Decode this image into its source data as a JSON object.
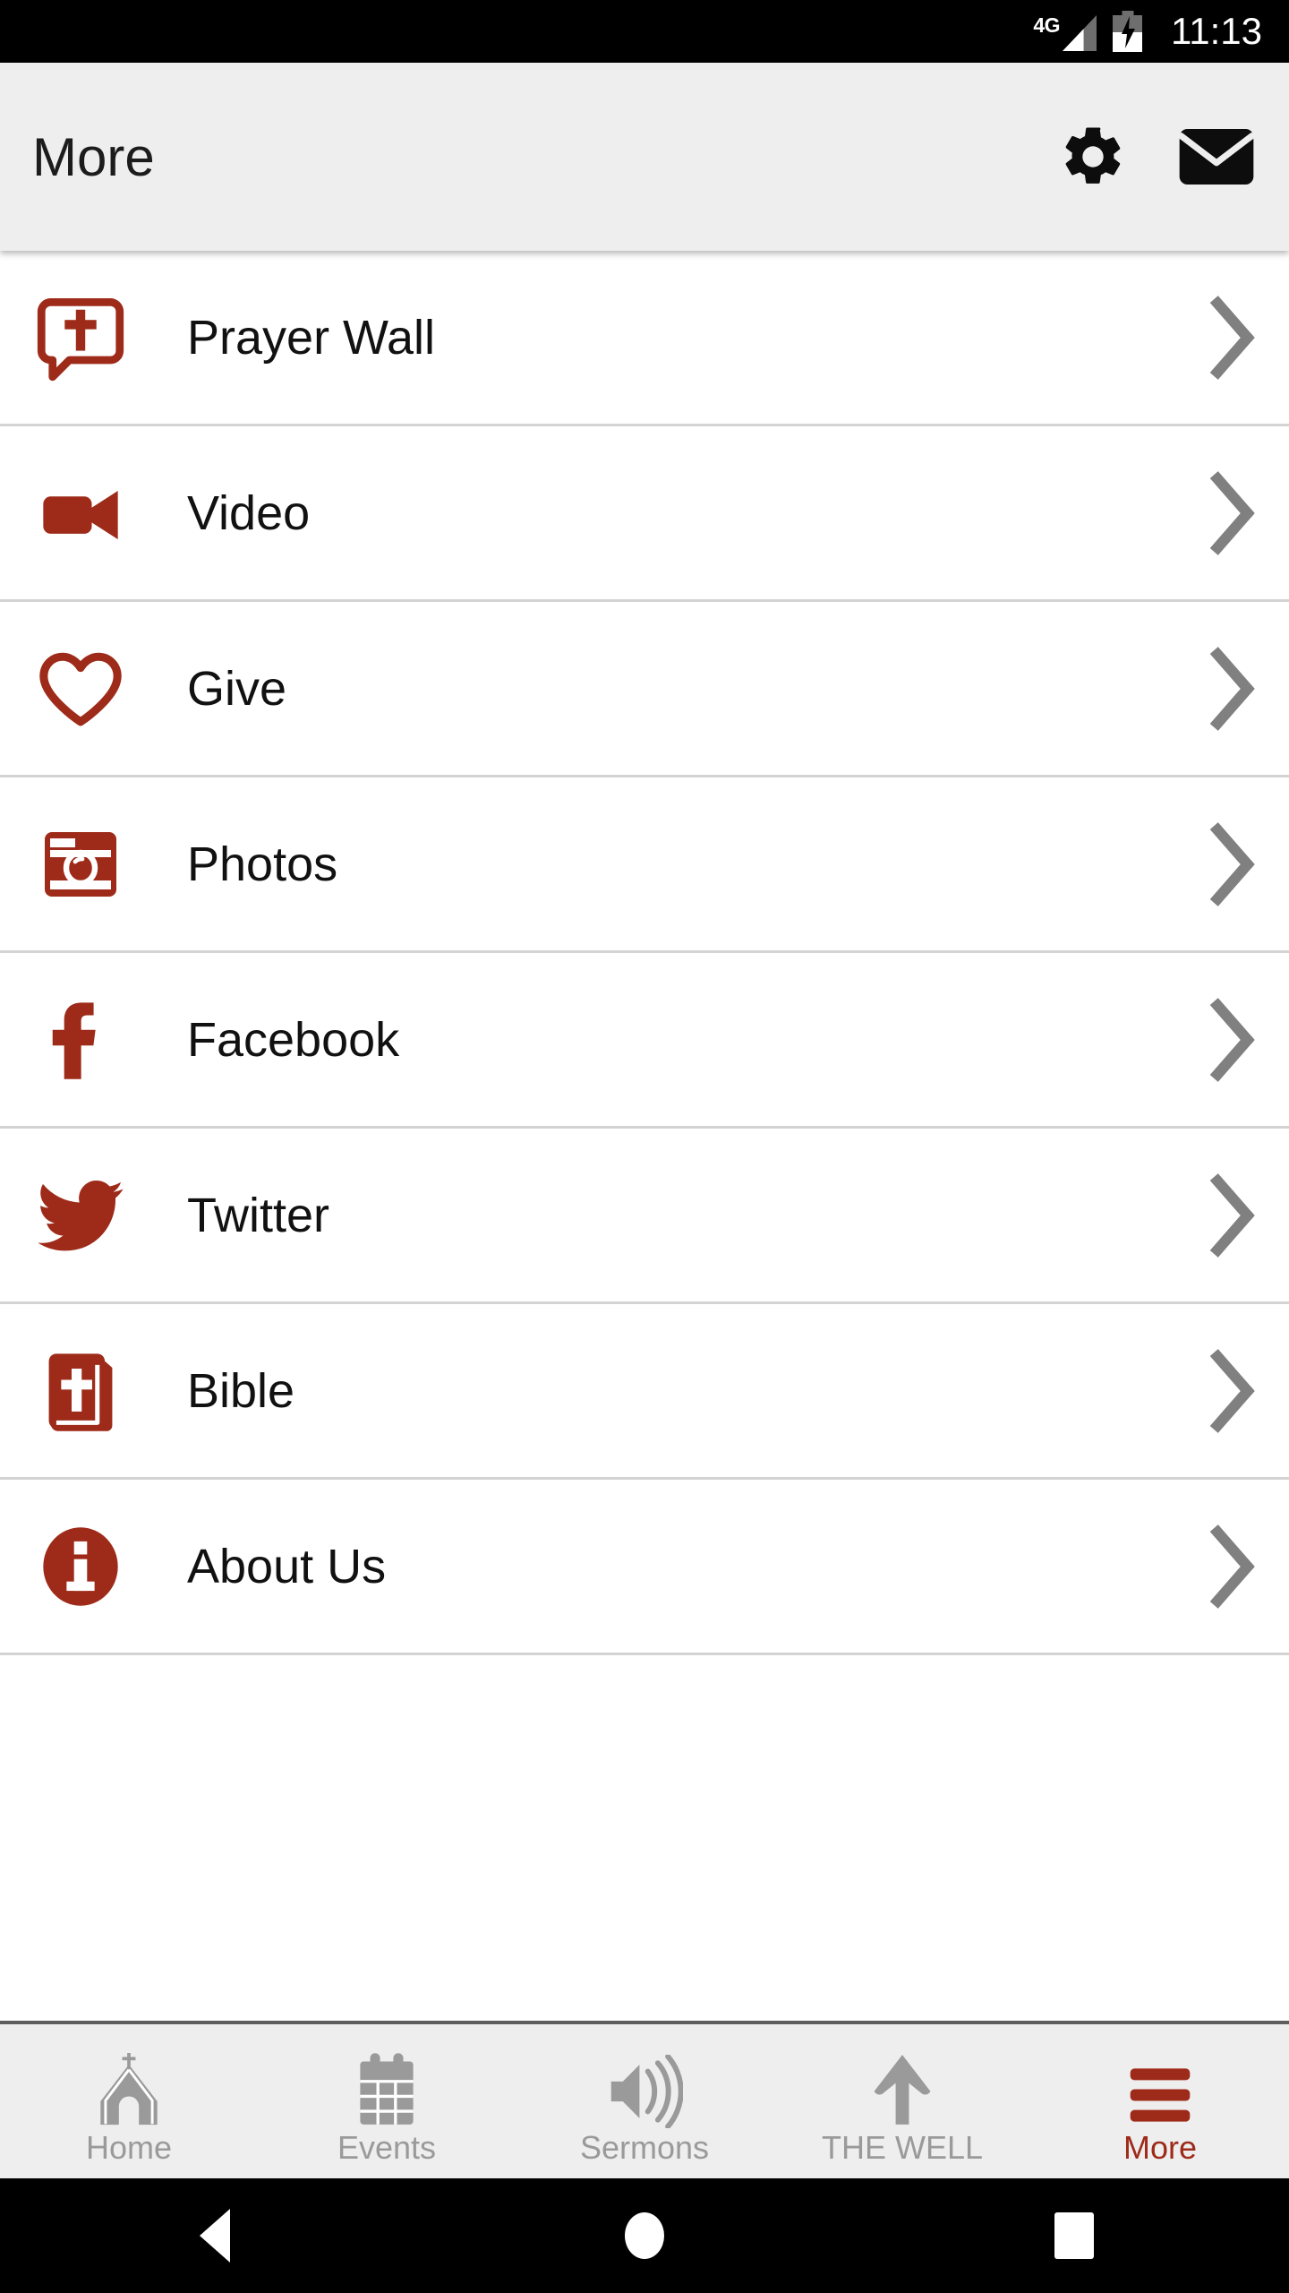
{
  "status_bar": {
    "network_label": "4G",
    "signal_icon": "signal-bars-icon",
    "battery_icon": "battery-charging-icon",
    "time": "11:13"
  },
  "header": {
    "title": "More",
    "actions": [
      {
        "name": "settings-button",
        "icon": "gear-icon"
      },
      {
        "name": "mail-button",
        "icon": "envelope-icon"
      }
    ]
  },
  "list": {
    "chevron_icon": "chevron-right-icon",
    "items": [
      {
        "label": "Prayer Wall",
        "icon": "prayer-speech-bubble-cross-icon"
      },
      {
        "label": "Video",
        "icon": "video-camera-icon"
      },
      {
        "label": "Give",
        "icon": "heart-outline-icon"
      },
      {
        "label": "Photos",
        "icon": "camera-icon"
      },
      {
        "label": "Facebook",
        "icon": "facebook-f-icon"
      },
      {
        "label": "Twitter",
        "icon": "twitter-bird-icon"
      },
      {
        "label": "Bible",
        "icon": "bible-book-cross-icon"
      },
      {
        "label": "About Us",
        "icon": "info-circle-icon"
      }
    ]
  },
  "bottom_nav": {
    "tabs": [
      {
        "label": "Home",
        "icon": "church-icon",
        "active": false
      },
      {
        "label": "Events",
        "icon": "calendar-icon",
        "active": false
      },
      {
        "label": "Sermons",
        "icon": "speaker-icon",
        "active": false
      },
      {
        "label": "THE WELL",
        "icon": "up-arrow-icon",
        "active": false
      },
      {
        "label": "More",
        "icon": "hamburger-menu-icon",
        "active": true
      }
    ]
  },
  "android_nav": {
    "back": "back-triangle-icon",
    "home": "home-circle-icon",
    "recents": "recents-square-icon"
  },
  "colors": {
    "brand_red": "#9E2B19",
    "header_bg": "#EEEEEE",
    "inactive_gray": "#9A9A9A",
    "chevron_gray": "#808080",
    "divider": "#D3D3D3"
  }
}
